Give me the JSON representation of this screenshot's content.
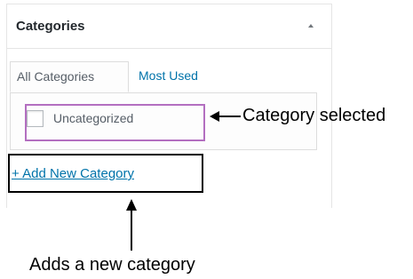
{
  "panel": {
    "title": "Categories",
    "toggle_icon": "triangle-up-icon"
  },
  "tabs": [
    {
      "label": "All Categories",
      "active": true
    },
    {
      "label": "Most Used",
      "active": false
    }
  ],
  "categories": [
    {
      "label": "Uncategorized",
      "checked": false
    }
  ],
  "add_link": {
    "label": "+ Add New Category"
  },
  "annotations": {
    "selected": "Category selected",
    "adds": "Adds a new category"
  },
  "colors": {
    "link": "#0073aa",
    "highlight": "#b36fc0",
    "text": "#555d66"
  }
}
